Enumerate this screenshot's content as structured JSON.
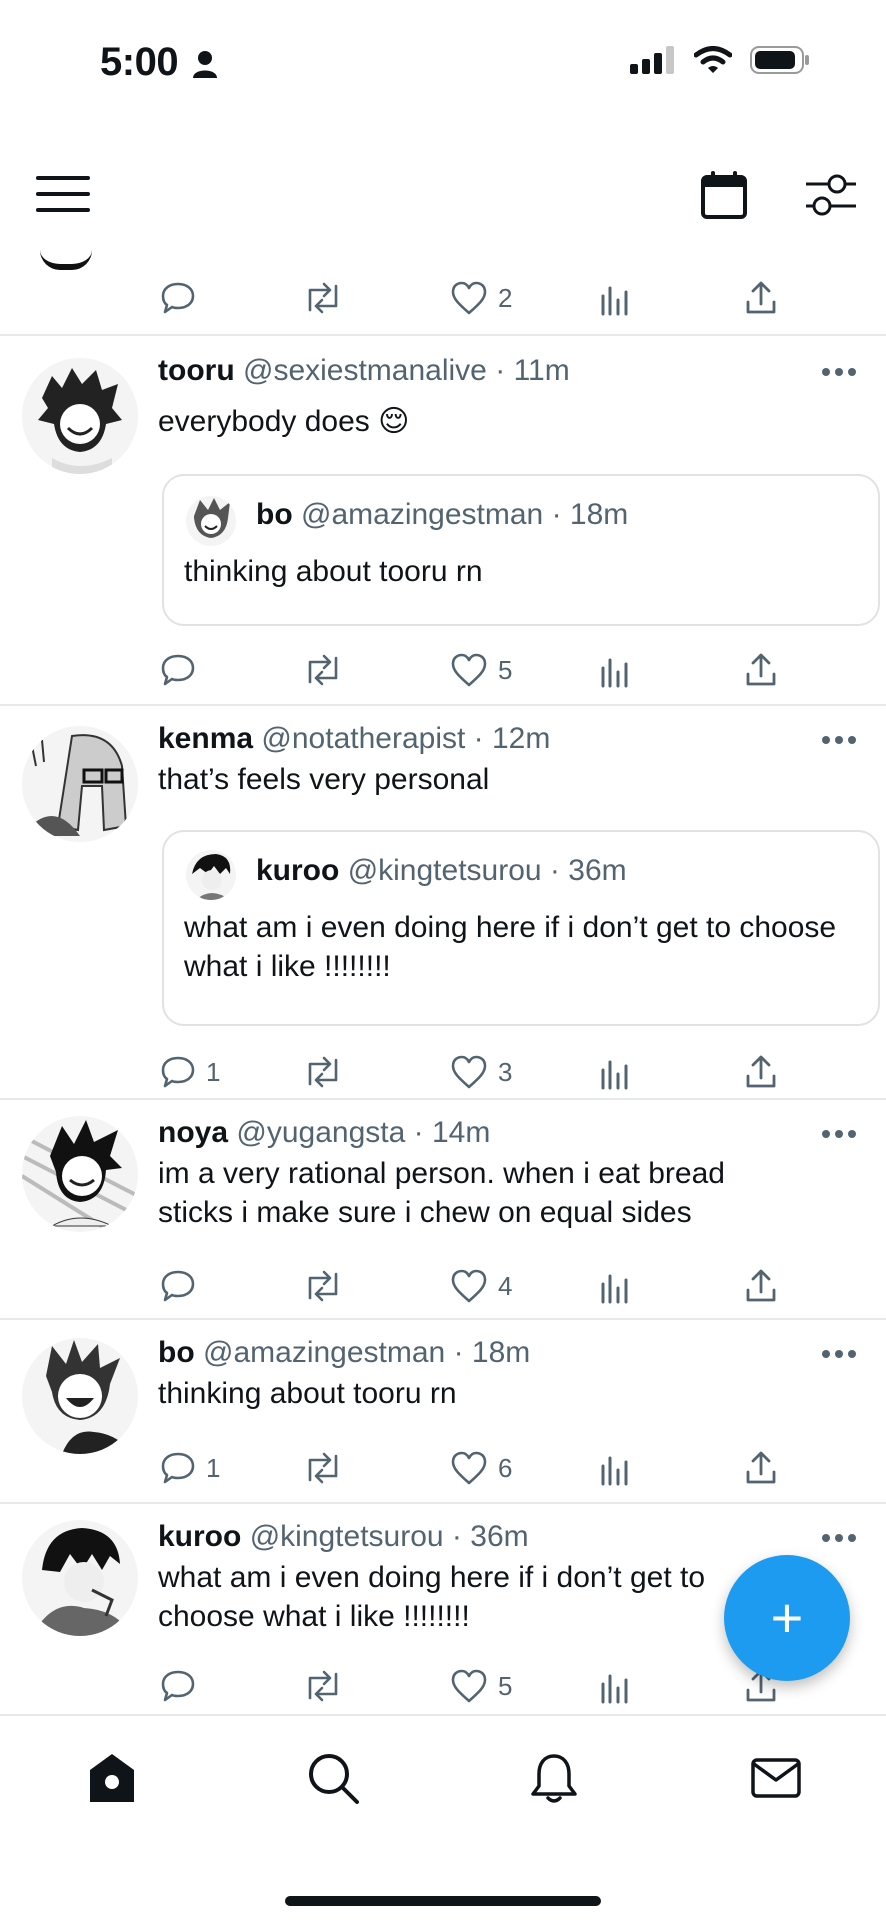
{
  "status_bar": {
    "time": "5:00"
  },
  "icons": {
    "person": "person-icon",
    "signal": "cellular-signal-icon",
    "wifi": "wifi-icon",
    "battery": "battery-icon",
    "menu": "hamburger-menu-icon",
    "calendar": "calendar-icon",
    "filter": "sliders-icon",
    "reply": "reply-icon",
    "retweet": "retweet-icon",
    "like": "heart-icon",
    "views": "views-icon",
    "share": "share-icon",
    "more": "more-icon",
    "compose": "plus-icon",
    "home": "home-icon",
    "search": "search-icon",
    "notifications": "bell-icon",
    "messages": "mail-icon"
  },
  "colors": {
    "accent": "#1d9bf0",
    "secondary_text": "#536471",
    "divider": "#e7e9eb"
  },
  "first_tweet_actions": {
    "reply_count": "",
    "like_count": "2"
  },
  "tweets": [
    {
      "name": "tooru",
      "handle": "@sexiestmanalive",
      "sep": "·",
      "time": "11m",
      "text": "everybody does 😌",
      "quote": {
        "name": "bo",
        "handle": "@amazingestman",
        "sep": "·",
        "time": "18m",
        "text": "thinking about tooru rn"
      },
      "reply_count": "",
      "like_count": "5"
    },
    {
      "name": "kenma",
      "handle": "@notatherapist",
      "sep": "·",
      "time": "12m",
      "text": "that’s feels very personal",
      "quote": {
        "name": "kuroo",
        "handle": "@kingtetsurou",
        "sep": "·",
        "time": "36m",
        "text": "what am i even doing here if i don’t get to choose what i like !!!!!!!!"
      },
      "reply_count": "1",
      "like_count": "3"
    },
    {
      "name": "noya",
      "handle": "@yugangsta",
      "sep": "·",
      "time": "14m",
      "text": "im a very rational person. when i eat bread sticks i make sure i chew on equal sides",
      "reply_count": "",
      "like_count": "4"
    },
    {
      "name": "bo",
      "handle": "@amazingestman",
      "sep": "·",
      "time": "18m",
      "text": "thinking about tooru rn",
      "reply_count": "1",
      "like_count": "6"
    },
    {
      "name": "kuroo",
      "handle": "@kingtetsurou",
      "sep": "·",
      "time": "36m",
      "text": "what am i even doing here if i don’t get to choose what i like !!!!!!!!",
      "reply_count": "",
      "like_count": "5"
    }
  ],
  "fab": {
    "label": "+"
  }
}
